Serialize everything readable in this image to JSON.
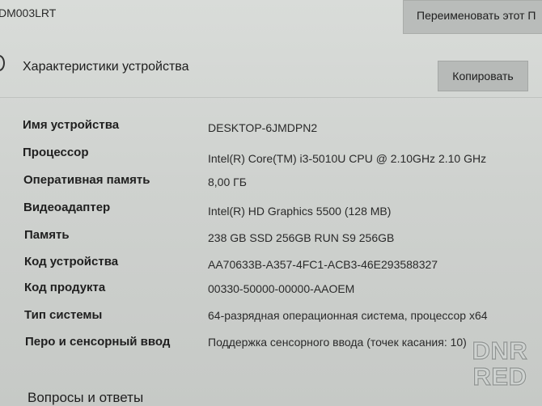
{
  "header": {
    "device_id_fragment": "DM003LRT",
    "rename_button_label": "Переименовать этот П"
  },
  "section": {
    "title": "Характеристики устройства",
    "copy_button_label": "Копировать"
  },
  "specs": [
    {
      "label": "Имя устройства",
      "value": "DESKTOP-6JMDPN2"
    },
    {
      "label": "Процессор",
      "value": "Intel(R) Core(TM) i3-5010U CPU @ 2.10GHz   2.10 GHz"
    },
    {
      "label": "Оперативная память",
      "value": "8,00 ГБ"
    },
    {
      "label": "Видеоадаптер",
      "value": "Intel(R) HD Graphics 5500 (128 MB)"
    },
    {
      "label": "Память",
      "value": "238 GB SSD 256GB RUN S9 256GB"
    },
    {
      "label": "Код устройства",
      "value": "AA70633B-A357-4FC1-ACB3-46E293588327"
    },
    {
      "label": "Код продукта",
      "value": "00330-50000-00000-AAOEM"
    },
    {
      "label": "Тип системы",
      "value": "64-разрядная операционная система, процессор x64"
    },
    {
      "label": "Перо и сенсорный ввод",
      "value": "Поддержка сенсорного ввода (точек касания: 10)"
    }
  ],
  "faq": {
    "title": "Вопросы и ответы"
  },
  "watermark": {
    "line1": "DNR",
    "line2": "RED"
  }
}
